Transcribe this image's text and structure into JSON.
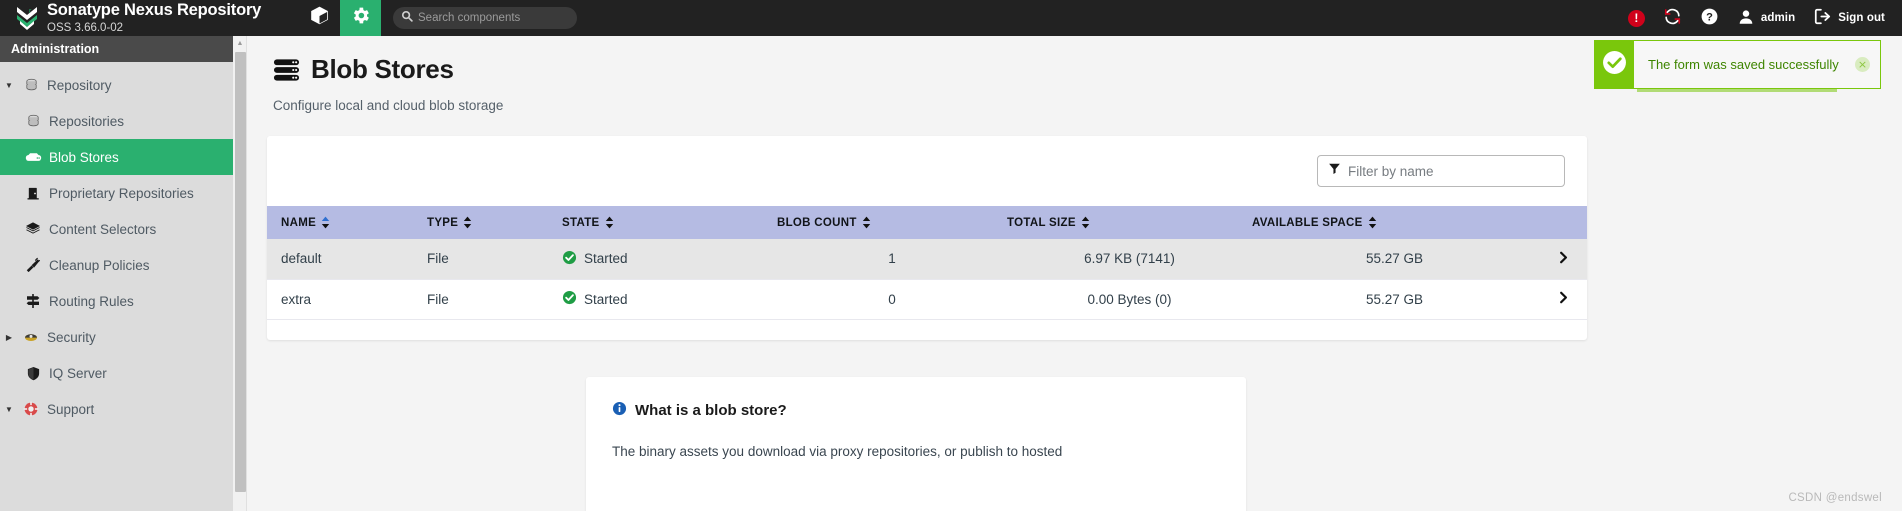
{
  "header": {
    "brand_title": "Sonatype Nexus Repository",
    "brand_subtitle": "OSS 3.66.0-02",
    "logo_icon": "nexus-chevrons-logo",
    "browse_icon": "cube-icon",
    "admin_icon": "gear-icon",
    "search": {
      "icon": "search-icon",
      "placeholder": "Search components",
      "value": ""
    },
    "right_items": [
      {
        "icon": "error-alert-icon",
        "label": ""
      },
      {
        "icon": "refresh-sync-icon",
        "label": ""
      },
      {
        "icon": "help-circle-icon",
        "label": ""
      },
      {
        "icon": "user-avatar-icon",
        "label": "admin"
      },
      {
        "icon": "sign-out-icon",
        "label": "Sign out"
      }
    ]
  },
  "sidebar": {
    "title": "Administration",
    "items": [
      {
        "label": "Repository",
        "icon": "database-icon",
        "level": 0,
        "caret": "expanded",
        "selected": false
      },
      {
        "label": "Repositories",
        "icon": "database-icon",
        "level": 1,
        "caret": "none",
        "selected": false
      },
      {
        "label": "Blob Stores",
        "icon": "blob-store-icon",
        "level": 1,
        "caret": "none",
        "selected": true
      },
      {
        "label": "Proprietary Repositories",
        "icon": "door-icon",
        "level": 1,
        "caret": "none",
        "selected": false
      },
      {
        "label": "Content Selectors",
        "icon": "layers-icon",
        "level": 1,
        "caret": "none",
        "selected": false
      },
      {
        "label": "Cleanup Policies",
        "icon": "broom-icon",
        "level": 1,
        "caret": "none",
        "selected": false
      },
      {
        "label": "Routing Rules",
        "icon": "signpost-icon",
        "level": 1,
        "caret": "none",
        "selected": false
      },
      {
        "label": "Security",
        "icon": "shield-badge-icon",
        "level": 0,
        "caret": "collapsed",
        "selected": false
      },
      {
        "label": "IQ Server",
        "icon": "shield-icon",
        "level": 1,
        "caret": "none",
        "selected": false
      },
      {
        "label": "Support",
        "icon": "lifebuoy-icon",
        "level": 0,
        "caret": "expanded",
        "selected": false
      }
    ]
  },
  "page": {
    "title": "Blob Stores",
    "title_icon": "blob-store-stack-icon",
    "subtitle": "Configure local and cloud blob storage"
  },
  "toast": {
    "icon": "check-circle-icon",
    "message": "The form was saved successfully",
    "close_label": "×",
    "accent_color": "#7ac70c",
    "text_color": "#3e8500"
  },
  "filter": {
    "icon": "funnel-icon",
    "placeholder": "Filter by name",
    "value": ""
  },
  "table": {
    "columns": [
      {
        "label": "NAME",
        "align": "left",
        "sorted": "asc"
      },
      {
        "label": "TYPE",
        "align": "left",
        "sorted": "none"
      },
      {
        "label": "STATE",
        "align": "left",
        "sorted": "none"
      },
      {
        "label": "BLOB COUNT",
        "align": "left",
        "sorted": "none"
      },
      {
        "label": "TOTAL SIZE",
        "align": "left",
        "sorted": "none"
      },
      {
        "label": "AVAILABLE SPACE",
        "align": "left",
        "sorted": "none"
      },
      {
        "label": "",
        "align": "right",
        "sorted": "none"
      }
    ],
    "rows": [
      {
        "name": "default",
        "type": "File",
        "state": "Started",
        "state_icon": "status-ok-icon",
        "blob_count": "1",
        "total_size": "6.97 KB (7141)",
        "available_space": "55.27 GB",
        "chevron": "chevron-right-icon",
        "hovered": true
      },
      {
        "name": "extra",
        "type": "File",
        "state": "Started",
        "state_icon": "status-ok-icon",
        "blob_count": "0",
        "total_size": "0.00 Bytes (0)",
        "available_space": "55.27 GB",
        "chevron": "chevron-right-icon",
        "hovered": false
      }
    ]
  },
  "info_panel": {
    "icon": "info-circle-icon",
    "title": "What is a blob store?",
    "body": "The binary assets you download via proxy repositories, or publish to hosted"
  },
  "watermark": "CSDN @endswel",
  "colors": {
    "topbar_bg": "#222222",
    "sidebar_bg": "#dcdcdc",
    "accent_green": "#2ab06f",
    "table_header_bg": "#b5bbe3",
    "toast_green": "#7ac70c",
    "error_red": "#d0021b",
    "info_blue": "#1a5fb4"
  }
}
